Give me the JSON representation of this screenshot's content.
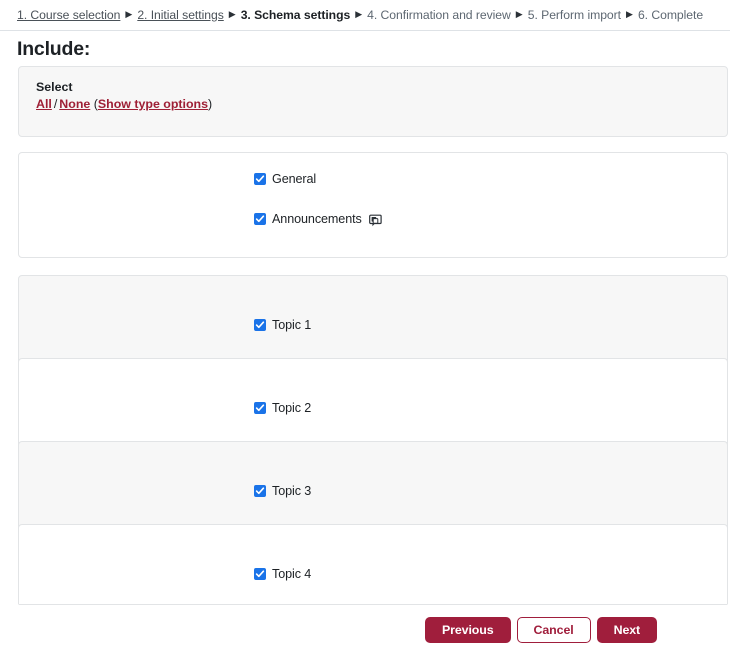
{
  "breadcrumb": {
    "steps": [
      {
        "label": "1. Course selection",
        "state": "link"
      },
      {
        "label": "2. Initial settings",
        "state": "link"
      },
      {
        "label": "3. Schema settings",
        "state": "current"
      },
      {
        "label": "4. Confirmation and review",
        "state": "plain"
      },
      {
        "label": "5. Perform import",
        "state": "plain"
      },
      {
        "label": "6. Complete",
        "state": "plain"
      }
    ],
    "separator": "▶"
  },
  "page": {
    "title": "Include:"
  },
  "select_panel": {
    "label": "Select",
    "all_label": "All",
    "separator": "/",
    "none_label": "None",
    "open_paren": "(",
    "type_options_label": "Show type options",
    "close_paren": ")"
  },
  "sections": [
    {
      "shaded": false,
      "items": [
        {
          "label": "General",
          "checked": true,
          "icon": null
        },
        {
          "label": "Announcements",
          "checked": true,
          "icon": "forum-icon"
        }
      ]
    },
    {
      "shaded": true,
      "items": [
        {
          "label": "Topic 1",
          "checked": true,
          "icon": null
        }
      ]
    },
    {
      "shaded": false,
      "items": [
        {
          "label": "Topic 2",
          "checked": true,
          "icon": null
        }
      ]
    },
    {
      "shaded": true,
      "items": [
        {
          "label": "Topic 3",
          "checked": true,
          "icon": null
        }
      ]
    },
    {
      "shaded": false,
      "items": [
        {
          "label": "Topic 4",
          "checked": true,
          "icon": null
        }
      ]
    }
  ],
  "footer": {
    "previous_label": "Previous",
    "cancel_label": "Cancel",
    "next_label": "Next"
  },
  "colors": {
    "brand_red": "#a01e3c",
    "link_red": "#9e1f35",
    "checkbox_blue": "#1a73e8",
    "card_shaded": "#f7f7f7",
    "card_border": "#e2e4e6",
    "text": "#1d2125"
  }
}
